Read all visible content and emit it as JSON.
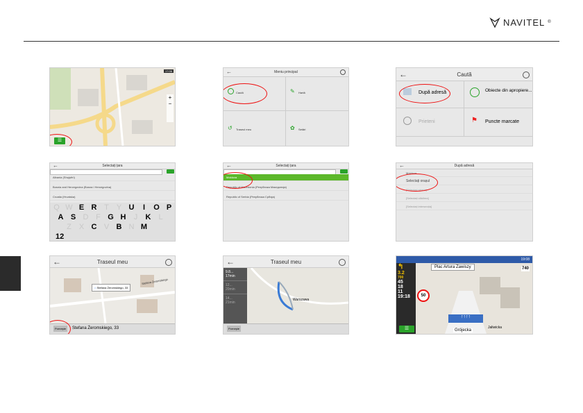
{
  "header": {
    "brand": "NAVITEL",
    "trademark": "®"
  },
  "s1": {
    "menu_icon": "menu-icon",
    "time": "17:06"
  },
  "s2": {
    "title": "Meniu principal",
    "items": [
      "Caută",
      "Hartă",
      "Traseul meu",
      "Setări"
    ]
  },
  "s3": {
    "title": "Caută",
    "items": [
      "După adresă",
      "Obiecte din apropiere...",
      "Prieteni",
      "Puncte marcate"
    ]
  },
  "s4": {
    "title": "Selectați țara",
    "rows": [
      "Albania (Shqipëri)",
      "Bosnia and Herzegovina (Bosna i Hercegovina)",
      "Croatia (Hrvatska)"
    ],
    "keys_row1": [
      "Q",
      "W",
      "E",
      "R",
      "T",
      "Y",
      "U",
      "I",
      "O",
      "P"
    ],
    "keys_row2": [
      "A",
      "S",
      "D",
      "F",
      "G",
      "H",
      "J",
      "K",
      "L"
    ],
    "keys_row3": [
      "Z",
      "X",
      "C",
      "V",
      "B",
      "N",
      "M"
    ],
    "num_key": "12"
  },
  "s5": {
    "title": "Selectați țara",
    "rows": [
      "Moldova",
      "Republic of Macedonia (Република Македонија)",
      "Republic of Serbia (Република Србија)"
    ]
  },
  "s6": {
    "title": "După adresă",
    "rows": [
      "Moldova",
      "Selectați orașul",
      "[Selectați strada]",
      "[Selectați clădirea]",
      "[Selectați intersecția]"
    ]
  },
  "s7": {
    "title": "Traseul meu",
    "popup": "Stefana Żeromskiego, 33",
    "route_label": "Porneşte",
    "address": "Stefana Żeromskiego, 33",
    "street": "Stefana Żeromskiego"
  },
  "s8": {
    "title": "Traseul meu",
    "routes": [
      {
        "dist": "9.8...",
        "time": "17min"
      },
      {
        "dist": "12...",
        "time": "20min"
      },
      {
        "dist": "14...",
        "time": "21min"
      }
    ],
    "city": "Warszawa",
    "route_label": "Porneşte"
  },
  "s9": {
    "clock": "19:08",
    "street": "Plac Artura Zawiszy",
    "dist_next": "740",
    "speed_limit": "50",
    "left_vals": [
      "3.2",
      "700",
      "45",
      "18",
      "11",
      "19:18"
    ],
    "bottom_street": "Grójecka",
    "side_street": "Jaliwicka",
    "turn_dist": "3.2"
  },
  "colors": {
    "accent": "#2aa32a",
    "highlight": "#e11111"
  }
}
